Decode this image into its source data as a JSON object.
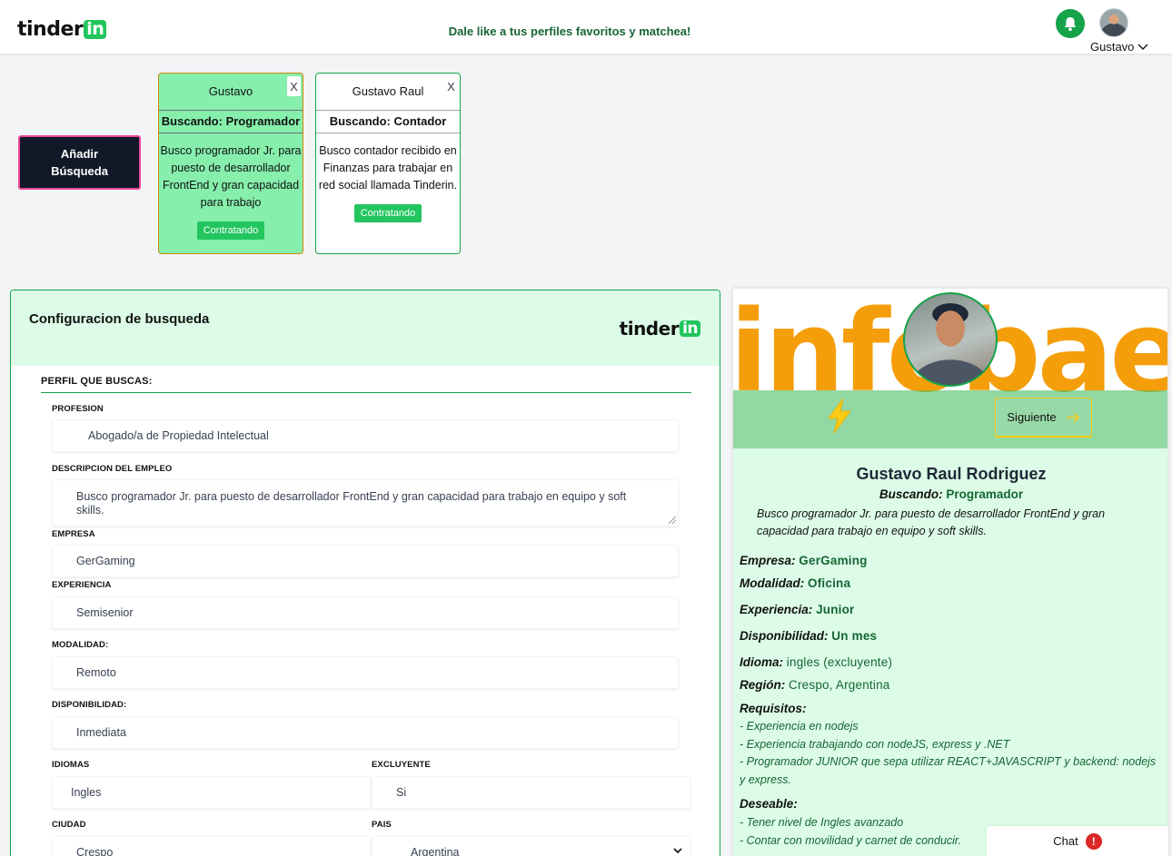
{
  "header": {
    "logo_main": "tinder",
    "logo_badge": "in",
    "tagline": "Dale like a tus perfiles favoritos y matchea!",
    "user_name": "Gustavo"
  },
  "add_search_label": "Añadir Búsqueda",
  "search_cards": [
    {
      "name": "Gustavo",
      "role": "Buscando: Programador",
      "description": "Busco programador Jr. para puesto de desarrollador FrontEnd y gran capacidad para trabajo",
      "status": "Contratando",
      "close": "X"
    },
    {
      "name": "Gustavo Raul",
      "role": "Buscando: Contador",
      "description": "Busco contador recibido en Finanzas para trabajar en red social llamada Tinderin.",
      "status": "Contratando",
      "close": "X"
    }
  ],
  "config": {
    "title": "Configuracion de busqueda",
    "section": "PERFIL QUE BUSCAS:",
    "fields": {
      "profesion": {
        "label": "PROFESION",
        "value": "Abogado/a de Propiedad Intelectual"
      },
      "descripcion": {
        "label": "DESCRIPCION DEL EMPLEO",
        "value": "Busco programador Jr. para puesto de desarrollador FrontEnd y gran capacidad para trabajo en equipo y soft skills."
      },
      "empresa": {
        "label": "EMPRESA",
        "value": "GerGaming"
      },
      "experiencia": {
        "label": "EXPERIENCIA",
        "value": "Semisenior"
      },
      "modalidad": {
        "label": "MODALIDAD:",
        "value": "Remoto"
      },
      "disponibilidad": {
        "label": "DISPONIBILIDAD:",
        "value": "Inmediata"
      },
      "idiomas": {
        "label": "IDIOMAS",
        "value": "Ingles"
      },
      "excluyente": {
        "label": "EXCLUYENTE",
        "value": "Si"
      },
      "ciudad": {
        "label": "CIUDAD",
        "value": "Crespo"
      },
      "pais": {
        "label": "PAIS",
        "value": "Argentina"
      }
    }
  },
  "profile": {
    "banner_text": "infobae",
    "next_label": "Siguiente",
    "name": "Gustavo Raul Rodriguez",
    "looking_label": "Buscando:",
    "looking_value": "Programador",
    "description": "Busco programador Jr. para puesto de desarrollador FrontEnd y gran capacidad para trabajo en equipo y soft skills.",
    "rows": {
      "empresa": {
        "label": "Empresa:",
        "value": "GerGaming"
      },
      "modalidad": {
        "label": "Modalidad:",
        "value": "Oficina"
      },
      "experiencia": {
        "label": "Experiencia:",
        "value": "Junior"
      },
      "disponibilidad": {
        "label": "Disponibilidad:",
        "value": "Un mes"
      },
      "idioma": {
        "label": "Idioma:",
        "value": "ingles (excluyente)"
      },
      "region": {
        "label": "Región:",
        "value": "Crespo, Argentina"
      }
    },
    "requisitos_label": "Requisitos:",
    "requisitos": [
      "- Experiencia en nodejs",
      "- Experiencia trabajando con nodeJS, express y .NET",
      "- Programador JUNIOR que sepa utilizar REACT+JAVASCRIPT y backend: nodejs y express."
    ],
    "deseable_label": "Deseable:",
    "deseable": [
      "- Tener nivel de Ingles avanzado",
      "- Contar con movilidad y carnet de conducir."
    ]
  },
  "chat": {
    "label": "Chat",
    "alert": "!"
  },
  "colors": {
    "brand_green": "#22c55e",
    "dark_green": "#166534",
    "panel_green": "#dcfce7",
    "card_active": "#86efac",
    "accent_pink": "#ec4899",
    "banner_orange": "#f59e0b"
  }
}
